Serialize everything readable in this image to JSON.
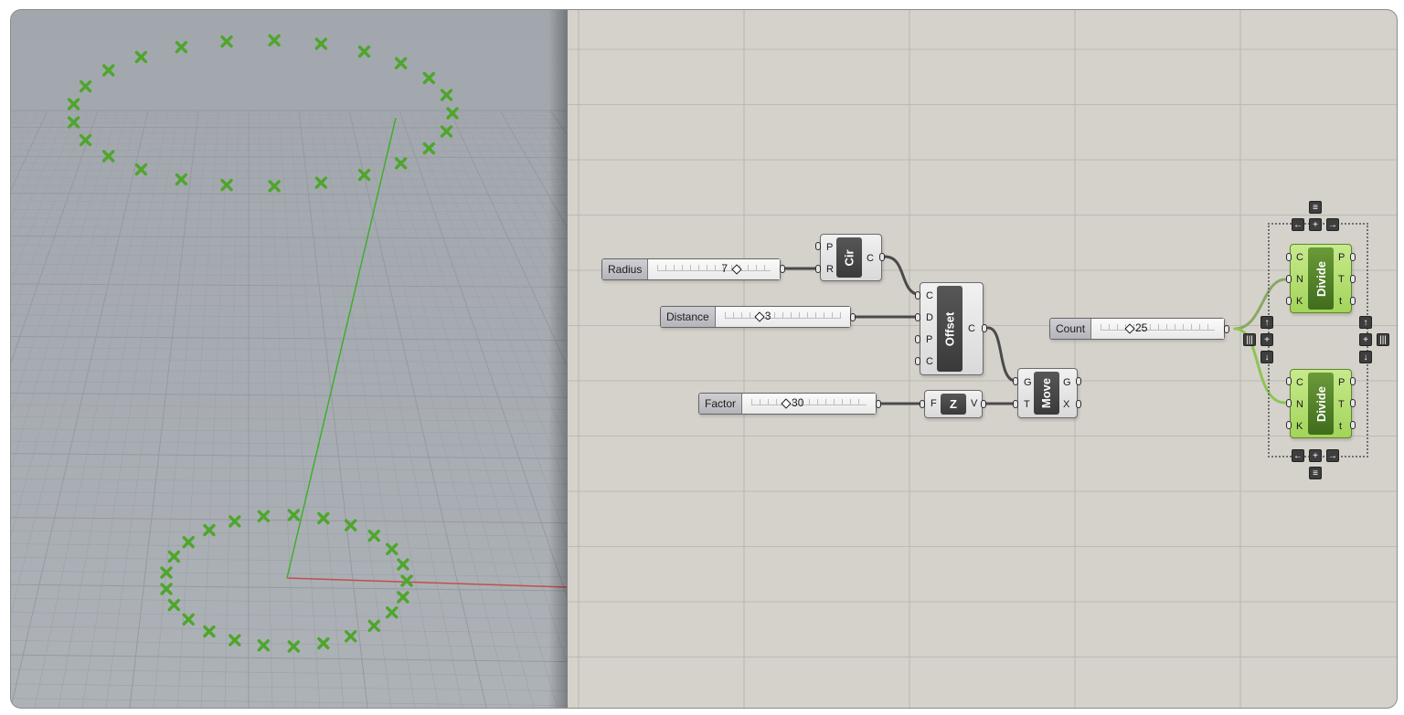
{
  "colors": {
    "point_marker": "#4ea62c",
    "z_axis": "#3fae2d",
    "x_axis": "#c0504d",
    "canvas_bg": "#d5d2cc",
    "viewport_bg": "#a6abb1",
    "active_component": "#a3d45a"
  },
  "viewport": {
    "icons": {
      "point_marker": "cross-marker-icon"
    }
  },
  "canvas": {
    "sliders": {
      "radius": {
        "label": "Radius",
        "value": "7"
      },
      "distance": {
        "label": "Distance",
        "value": "3"
      },
      "factor": {
        "label": "Factor",
        "value": "30"
      },
      "count": {
        "label": "Count",
        "value": "25"
      }
    },
    "components": {
      "circle": {
        "name": "Cir",
        "inputs": [
          "P",
          "R"
        ],
        "outputs": [
          "C"
        ]
      },
      "offset": {
        "name": "Offset",
        "inputs": [
          "C",
          "D",
          "P",
          "C"
        ],
        "outputs": [
          "C"
        ]
      },
      "zvec": {
        "name": "Z",
        "inputs": [
          "F"
        ],
        "outputs": [
          "V"
        ]
      },
      "move": {
        "name": "Move",
        "inputs": [
          "G",
          "T"
        ],
        "outputs": [
          "G",
          "X"
        ]
      },
      "divide_top": {
        "name": "Divide",
        "inputs": [
          "C",
          "N",
          "K"
        ],
        "outputs": [
          "P",
          "T",
          "t"
        ]
      },
      "divide_bottom": {
        "name": "Divide",
        "inputs": [
          "C",
          "N",
          "K"
        ],
        "outputs": [
          "P",
          "T",
          "t"
        ]
      }
    },
    "controls": {
      "up": "↑",
      "down": "↓",
      "left": "←",
      "right": "→",
      "plus": "+",
      "menu": "≡",
      "bars": "|||"
    }
  }
}
